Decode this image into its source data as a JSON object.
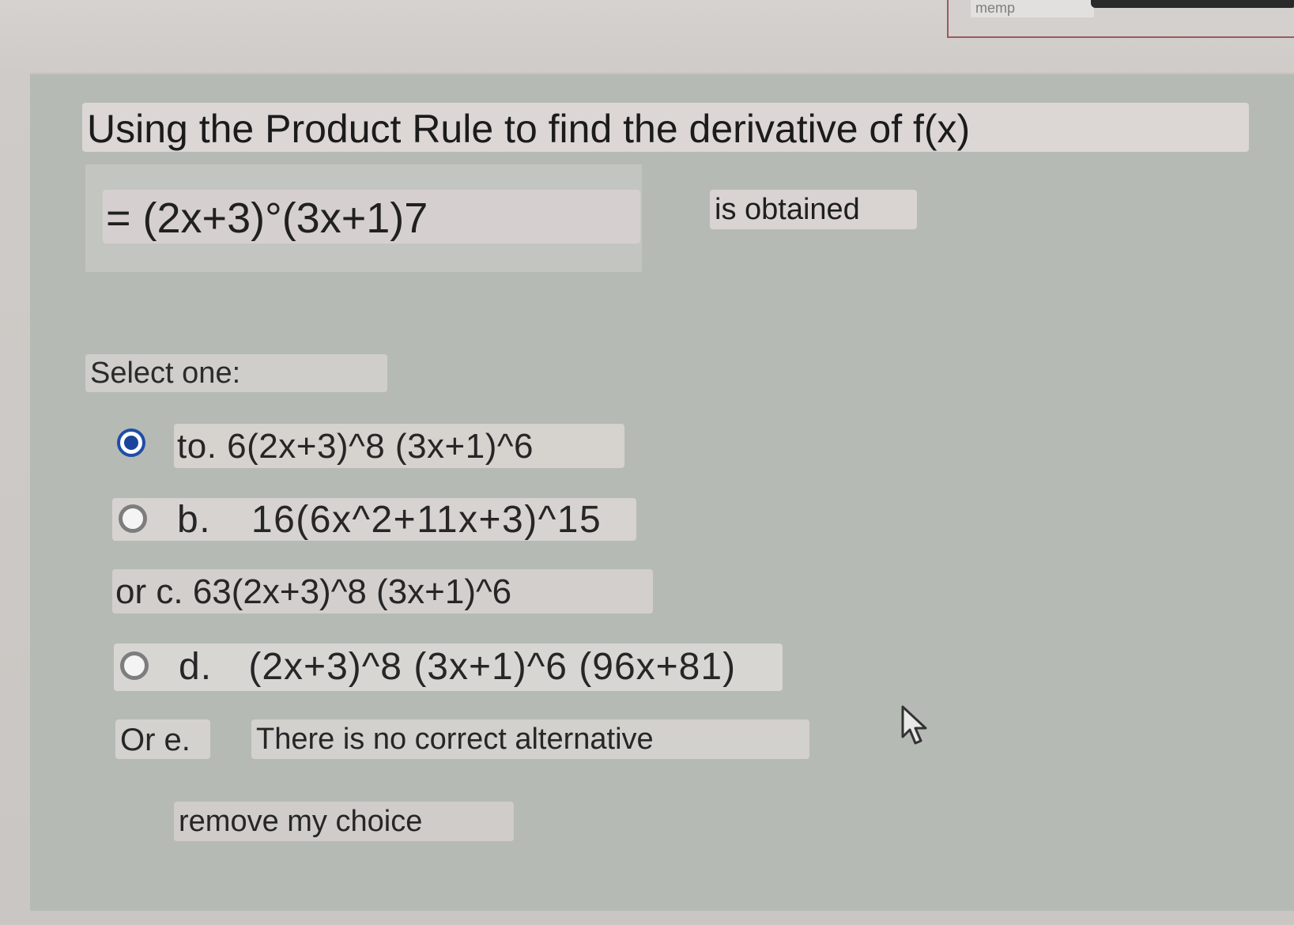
{
  "top_field": {
    "value": "memp"
  },
  "question": {
    "title": "Using the Product Rule to find the derivative of f(x)",
    "formula": "= (2x+3)°(3x+1)7",
    "suffix": "is obtained"
  },
  "select_label": "Select one:",
  "options": [
    {
      "marker": "to.",
      "text": "6(2x+3)^8 (3x+1)^6",
      "selected": true
    },
    {
      "marker": "b.",
      "text": "16(6x^2+11x+3)^15",
      "selected": false
    },
    {
      "marker": "or c.",
      "text": "63(2x+3)^8 (3x+1)^6",
      "selected": false
    },
    {
      "marker": "d.",
      "text": "(2x+3)^8 (3x+1)^6 (96x+81)",
      "selected": false
    },
    {
      "marker": "Or e.",
      "text": "There is no correct alternative",
      "selected": false
    }
  ],
  "remove_label": "remove my choice",
  "colors": {
    "panel": "#b6bab5",
    "radio_selected": "#1b4399",
    "label_bg": "#d8d4d1"
  },
  "icons": {
    "cursor": "mouse-pointer-icon"
  }
}
